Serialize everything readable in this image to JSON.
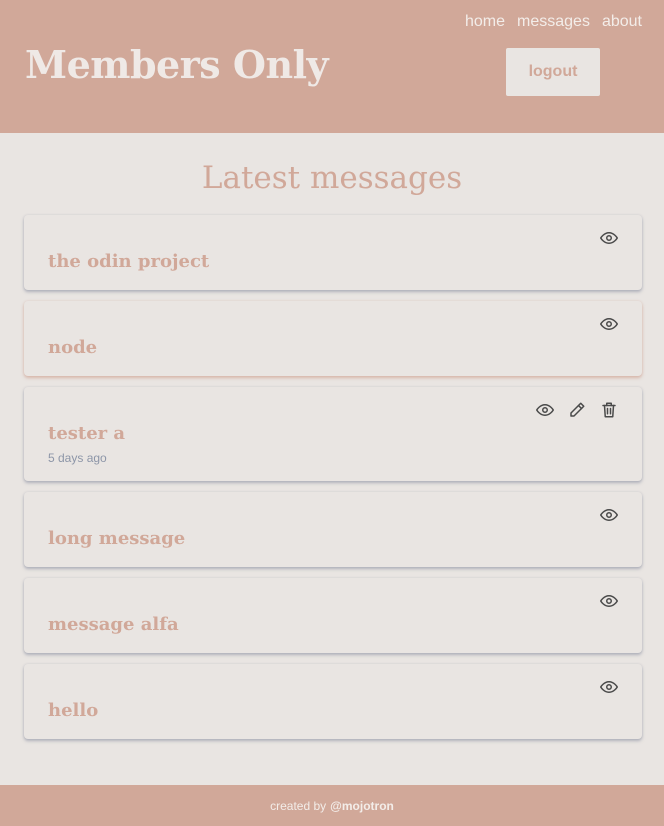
{
  "header": {
    "title": "Members Only",
    "nav": [
      "home",
      "messages",
      "about"
    ],
    "logout_label": "logout"
  },
  "main": {
    "heading": "Latest messages",
    "messages": [
      {
        "title": "the odin project",
        "actions": [
          "eye-icon"
        ]
      },
      {
        "title": "node",
        "actions": [
          "eye-icon"
        ]
      },
      {
        "title": "tester a",
        "date": "5 days ago",
        "actions": [
          "eye-icon",
          "pencil-icon",
          "trash-icon"
        ]
      },
      {
        "title": "long message",
        "actions": [
          "eye-icon"
        ]
      },
      {
        "title": "message alfa",
        "actions": [
          "eye-icon"
        ]
      },
      {
        "title": "hello",
        "actions": [
          "eye-icon"
        ]
      }
    ]
  },
  "footer": {
    "prefix": "created by",
    "author": "@mojotron"
  },
  "colors": {
    "accent": "#d1a899",
    "background": "#e9e5e2",
    "icon": "#4a4a4a",
    "muted": "#8d96a8"
  }
}
